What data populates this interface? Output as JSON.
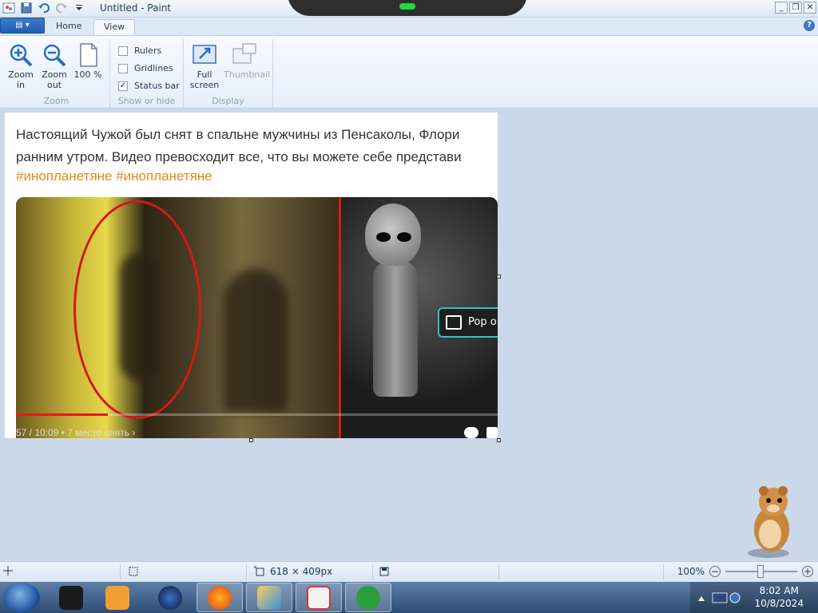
{
  "window": {
    "title": "Untitled - Paint"
  },
  "tabs": {
    "home": "Home",
    "view": "View"
  },
  "ribbon": {
    "zoom_group": {
      "label": "Zoom",
      "zoom_in": "Zoom in",
      "zoom_out": "Zoom out",
      "hundred": "100 %"
    },
    "show_group": {
      "label": "Show or hide",
      "rulers": "Rulers",
      "gridlines": "Gridlines",
      "status_bar": "Status bar",
      "rulers_checked": false,
      "gridlines_checked": false,
      "status_bar_checked": true
    },
    "display_group": {
      "label": "Display",
      "full_screen": "Full screen",
      "thumbnail": "Thumbnail"
    }
  },
  "canvas": {
    "post_line1": "Настоящий Чужой был снят в спальне мужчины из Пенсаколы, Флори",
    "post_line2": "ранним утром. Видео превосходит все, что вы можете себе представи",
    "tags": "#инопланетяне #инопланетяне",
    "popout_label": "Pop o",
    "video_time": "57 / 10:09  •  7 место опять  ›",
    "video_progress": 0.19
  },
  "statusbar": {
    "size": "618 × 409px",
    "zoom": "100%"
  },
  "taskbar": {
    "time": "8:02 AM",
    "date": "10/8/2024"
  },
  "colors": {
    "accent": "#1f5eb3",
    "tag": "#e08a1c",
    "ellipse": "#d41818",
    "popout_border": "#2ec4c4"
  }
}
